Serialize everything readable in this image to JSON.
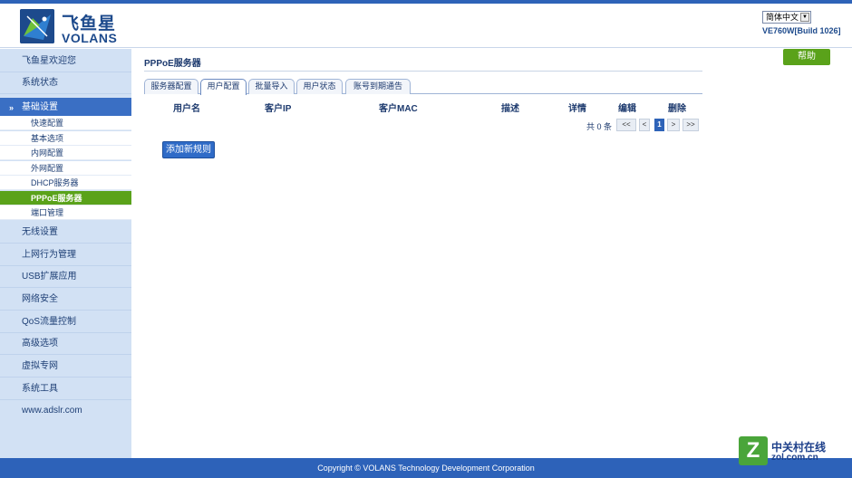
{
  "header": {
    "logo_cn": "飞鱼星",
    "logo_en": "VOLANS",
    "language": "简体中文",
    "version": "VE760W[Build 1026]"
  },
  "sidebar": {
    "top_items": [
      "飞鱼星欢迎您",
      "系统状态"
    ],
    "group_label": "基础设置",
    "sub_items": [
      "快速配置",
      "基本选项",
      "内网配置",
      "外网配置",
      "DHCP服务器",
      "PPPoE服务器",
      "端口管理"
    ],
    "active_sub": "PPPoE服务器",
    "bottom_items": [
      "无线设置",
      "上网行为管理",
      "USB扩展应用",
      "网络安全",
      "QoS流量控制",
      "高级选项",
      "虚拟专网",
      "系统工具",
      "www.adslr.com"
    ]
  },
  "main": {
    "title": "PPPoE服务器",
    "help_label": "帮助",
    "tabs": [
      "服务器配置",
      "用户配置",
      "批量导入",
      "用户状态",
      "账号到期通告"
    ],
    "active_tab": "用户配置",
    "columns": [
      "用户名",
      "客户IP",
      "客户MAC",
      "描述",
      "详情",
      "编辑",
      "删除"
    ],
    "pager": {
      "total": "共 0 条",
      "first": "<<",
      "prev": "<",
      "current": "1",
      "next": ">",
      "last": ">>"
    },
    "add_label": "添加新规则"
  },
  "footer": {
    "copyright": "Copyright © VOLANS Technology Development Corporation"
  },
  "watermark": {
    "cn": "中关村在线",
    "en": "zol.com.cn"
  },
  "colors": {
    "brand_blue": "#2e63b8",
    "active_green": "#5aa21a",
    "sidebar_bg": "#d2e1f4"
  }
}
